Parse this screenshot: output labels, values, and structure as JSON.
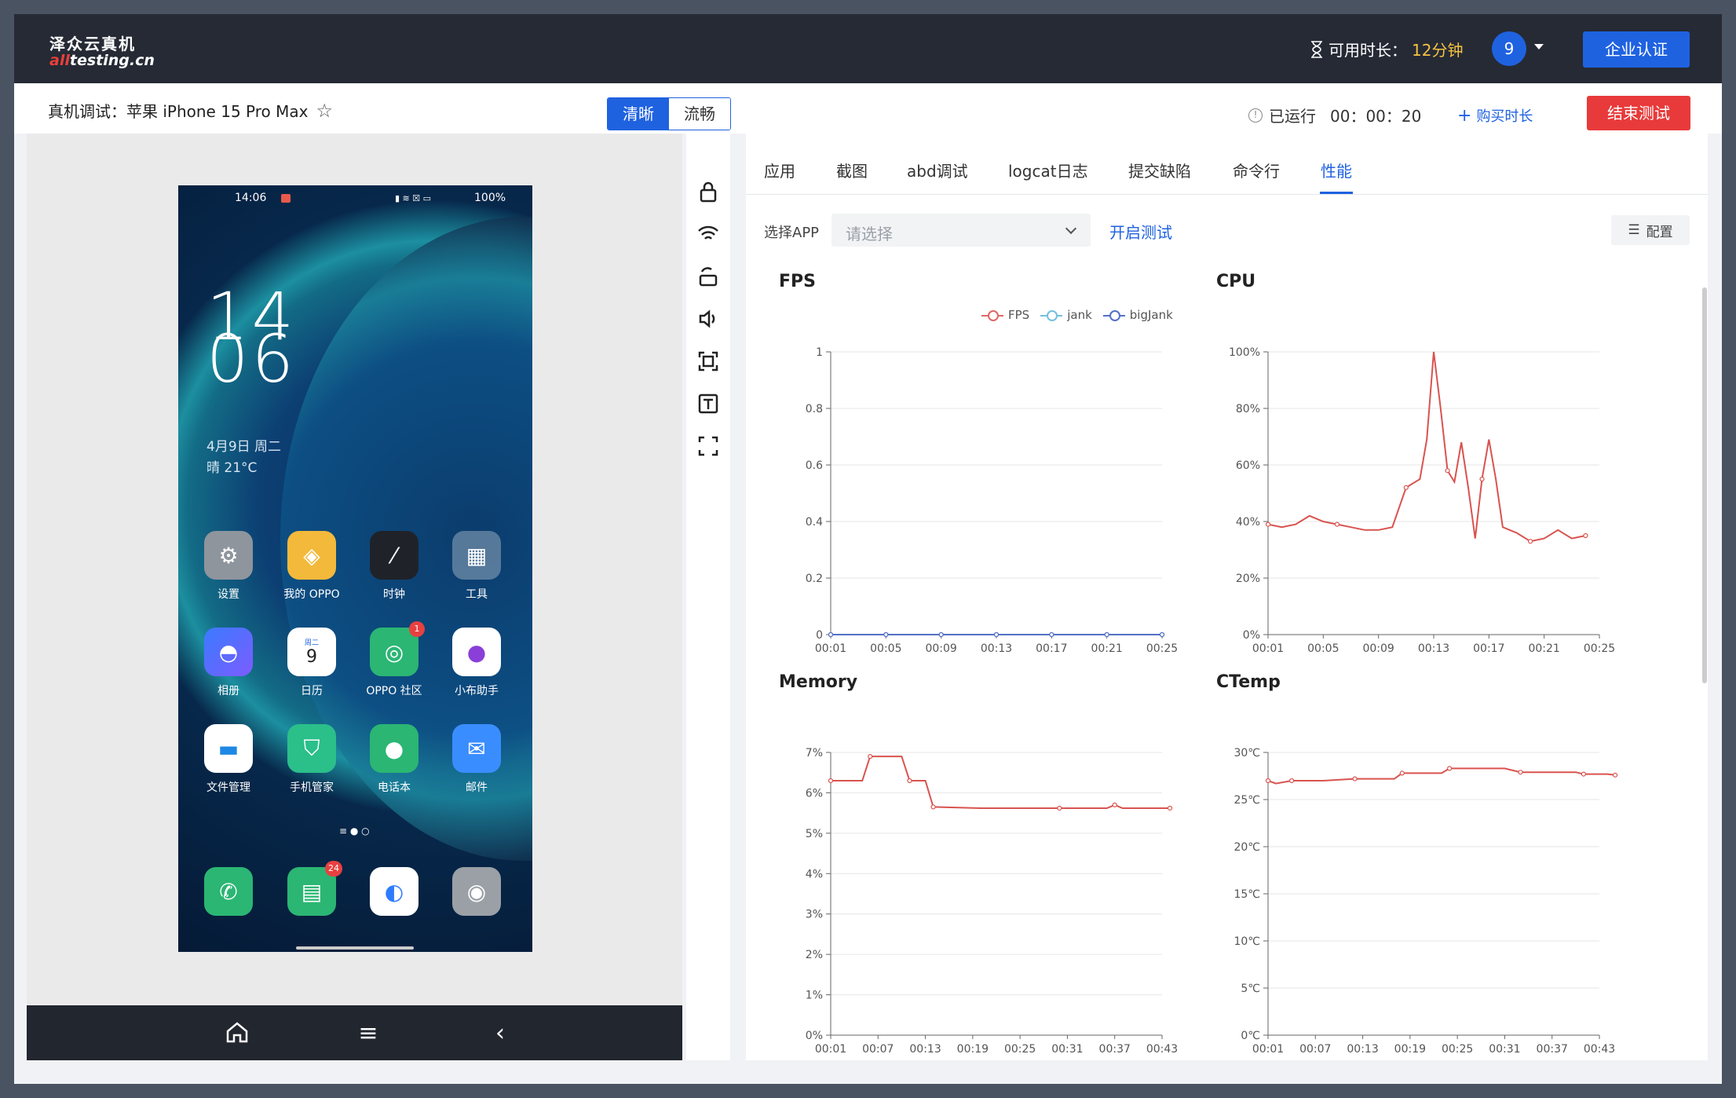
{
  "topbar": {
    "logo_cn": "泽众云真机",
    "logo_en_red": "all",
    "logo_en_rest": "testing.cn",
    "available_label": "可用时长：",
    "available_value": "12分钟",
    "user_number": "9",
    "enterprise_btn": "企业认证"
  },
  "subbar": {
    "device_title": "真机调试：苹果 iPhone 15 Pro Max",
    "quality_options": [
      "清晰",
      "流畅"
    ],
    "running_label": "已运行",
    "running_time": "00：00：20",
    "buy_label": "购买时长",
    "end_btn": "结束测试"
  },
  "phone": {
    "status_time": "14:06",
    "status_right": "100%",
    "clock_h": "14",
    "clock_m": "06",
    "date": "4月9日 周二",
    "weather": "晴 21°C",
    "calendar_day": "9",
    "calendar_weekday": "周二",
    "apps": [
      {
        "label": "设置",
        "icon": "gear-icon"
      },
      {
        "label": "我的 OPPO",
        "icon": "diamond-icon"
      },
      {
        "label": "时钟",
        "icon": "clock-icon"
      },
      {
        "label": "工具",
        "icon": "tools-folder-icon"
      },
      {
        "label": "相册",
        "icon": "photos-icon"
      },
      {
        "label": "日历",
        "icon": "calendar-icon"
      },
      {
        "label": "OPPO 社区",
        "icon": "community-icon",
        "badge": "1"
      },
      {
        "label": "小布助手",
        "icon": "assistant-icon"
      },
      {
        "label": "文件管理",
        "icon": "folder-icon"
      },
      {
        "label": "手机管家",
        "icon": "shield-icon"
      },
      {
        "label": "电话本",
        "icon": "contacts-icon"
      },
      {
        "label": "邮件",
        "icon": "mail-icon"
      }
    ],
    "dock": [
      {
        "icon": "phone-icon"
      },
      {
        "icon": "messages-icon",
        "badge": "24"
      },
      {
        "icon": "browser-icon"
      },
      {
        "icon": "camera-icon"
      }
    ]
  },
  "tabs": [
    "应用",
    "截图",
    "abd调试",
    "logcat日志",
    "提交缺陷",
    "命令行",
    "性能"
  ],
  "active_tab": "性能",
  "perf": {
    "select_label": "选择APP",
    "select_placeholder": "请选择",
    "start_label": "开启测试",
    "config_label": "配置"
  },
  "chart_data": [
    {
      "type": "line",
      "title": "FPS",
      "x": [
        "00:01",
        "00:05",
        "00:09",
        "00:13",
        "00:17",
        "00:21",
        "00:25"
      ],
      "ylim": [
        0,
        1
      ],
      "yticks": [
        "0",
        "0.2",
        "0.4",
        "0.6",
        "0.8",
        "1"
      ],
      "legend": [
        "FPS",
        "jank",
        "bigJank"
      ],
      "legend_position": "top-right",
      "series": [
        {
          "name": "FPS",
          "color": "#e06666",
          "values": [
            0,
            0,
            0,
            0,
            0,
            0,
            0
          ]
        },
        {
          "name": "jank",
          "color": "#73c0de",
          "values": [
            0,
            0,
            0,
            0,
            0,
            0,
            0
          ]
        },
        {
          "name": "bigJank",
          "color": "#5470c6",
          "values": [
            0,
            0,
            0,
            0,
            0,
            0,
            0
          ]
        }
      ]
    },
    {
      "type": "line",
      "title": "CPU",
      "x": [
        "00:01",
        "00:05",
        "00:09",
        "00:13",
        "00:17",
        "00:21",
        "00:25"
      ],
      "ylim": [
        0,
        100
      ],
      "yticks": [
        "0%",
        "20%",
        "40%",
        "60%",
        "80%",
        "100%"
      ],
      "series": [
        {
          "color": "#d9534f",
          "points": [
            [
              1,
              39
            ],
            [
              2,
              38
            ],
            [
              3,
              39
            ],
            [
              4,
              42
            ],
            [
              5,
              40
            ],
            [
              6,
              39
            ],
            [
              7,
              38
            ],
            [
              8,
              37
            ],
            [
              9,
              37
            ],
            [
              10,
              38
            ],
            [
              11,
              52
            ],
            [
              12,
              55
            ],
            [
              12.5,
              69
            ],
            [
              13,
              100
            ],
            [
              13.5,
              80
            ],
            [
              14,
              58
            ],
            [
              14.5,
              54
            ],
            [
              15,
              68
            ],
            [
              15.5,
              52
            ],
            [
              16,
              34
            ],
            [
              16.5,
              55
            ],
            [
              17,
              69
            ],
            [
              17.5,
              55
            ],
            [
              18,
              38
            ],
            [
              19,
              36
            ],
            [
              20,
              33
            ],
            [
              21,
              34
            ],
            [
              22,
              37
            ],
            [
              23,
              34
            ],
            [
              24,
              35
            ]
          ]
        }
      ]
    },
    {
      "type": "line",
      "title": "Memory",
      "x": [
        "00:01",
        "00:07",
        "00:13",
        "00:19",
        "00:25",
        "00:31",
        "00:37",
        "00:43"
      ],
      "ylim": [
        0,
        7
      ],
      "yticks": [
        "0%",
        "1%",
        "2%",
        "3%",
        "4%",
        "5%",
        "6%",
        "7%"
      ],
      "series": [
        {
          "color": "#d9534f",
          "points": [
            [
              1,
              6.3
            ],
            [
              5,
              6.3
            ],
            [
              6,
              6.9
            ],
            [
              10,
              6.9
            ],
            [
              11,
              6.3
            ],
            [
              13,
              6.3
            ],
            [
              14,
              5.65
            ],
            [
              20,
              5.62
            ],
            [
              30,
              5.62
            ],
            [
              36,
              5.62
            ],
            [
              37,
              5.7
            ],
            [
              38,
              5.62
            ],
            [
              44,
              5.62
            ]
          ]
        }
      ]
    },
    {
      "type": "line",
      "title": "CTemp",
      "x": [
        "00:01",
        "00:07",
        "00:13",
        "00:19",
        "00:25",
        "00:31",
        "00:37",
        "00:43"
      ],
      "ylim": [
        0,
        30
      ],
      "yticks": [
        "0℃",
        "5℃",
        "10℃",
        "15℃",
        "20℃",
        "25℃",
        "30℃"
      ],
      "series": [
        {
          "color": "#d9534f",
          "points": [
            [
              1,
              27
            ],
            [
              2,
              26.7
            ],
            [
              4,
              27
            ],
            [
              8,
              27
            ],
            [
              12,
              27.2
            ],
            [
              17,
              27.2
            ],
            [
              18,
              27.8
            ],
            [
              23,
              27.8
            ],
            [
              24,
              28.3
            ],
            [
              31,
              28.3
            ],
            [
              33,
              27.9
            ],
            [
              40,
              27.9
            ],
            [
              41,
              27.7
            ],
            [
              44,
              27.7
            ],
            [
              45,
              27.6
            ]
          ]
        }
      ]
    }
  ]
}
